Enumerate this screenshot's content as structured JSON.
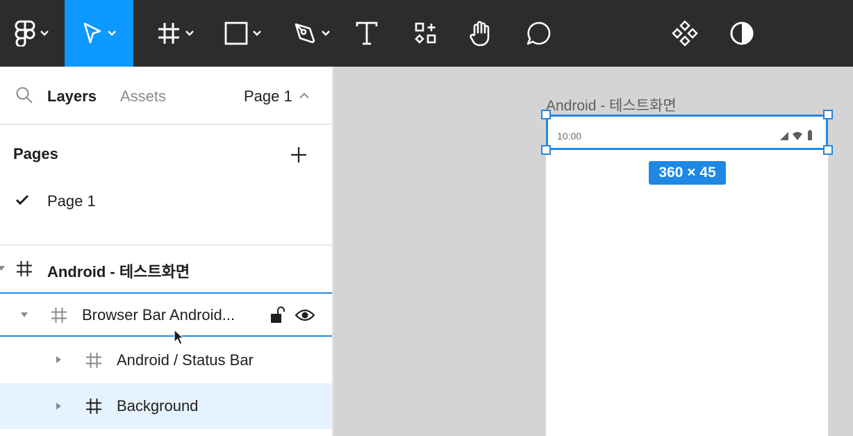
{
  "toolbar": {
    "tools": [
      "main-menu",
      "move",
      "frame",
      "shape",
      "pen",
      "text",
      "resources",
      "hand",
      "comment",
      "components",
      "theme"
    ]
  },
  "sidebar": {
    "tabs": {
      "layers": "Layers",
      "assets": "Assets",
      "page_selector": "Page 1"
    },
    "pages_title": "Pages",
    "pages": [
      {
        "label": "Page 1",
        "current": true
      }
    ],
    "layers": [
      {
        "label": "Android - 테스트화면",
        "level": 0,
        "expanded": true
      },
      {
        "label": "Browser Bar Android...",
        "level": 1,
        "expanded": true,
        "hovered": true
      },
      {
        "label": "Android / Status Bar",
        "level": 2,
        "expanded": false
      },
      {
        "label": "Background",
        "level": 2,
        "expanded": false,
        "selected": true
      }
    ]
  },
  "canvas": {
    "frame_title": "Android - 테스트화면",
    "status_time": "10:00",
    "dimension_badge": "360 × 45"
  },
  "colors": {
    "toolbar_bg": "#2c2c2c",
    "accent": "#0d99ff",
    "selection": "#1e88e5",
    "selected_row": "#e5f2ff",
    "canvas_bg": "#d4d4d4"
  }
}
